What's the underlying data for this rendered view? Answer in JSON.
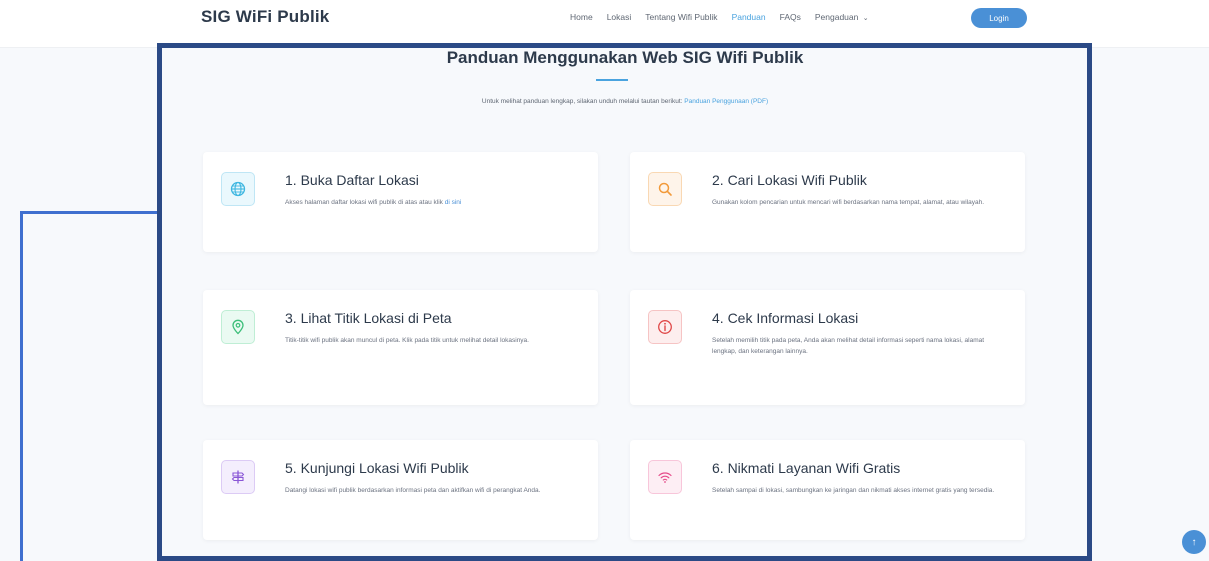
{
  "header": {
    "brand": "SIG WiFi Publik",
    "nav": [
      {
        "label": "Home"
      },
      {
        "label": "Lokasi"
      },
      {
        "label": "Tentang Wifi Publik"
      },
      {
        "label": "Panduan"
      },
      {
        "label": "FAQs"
      },
      {
        "label": "Pengaduan"
      }
    ],
    "nav_dropdown_caret": "⌄",
    "login_label": "Login"
  },
  "section": {
    "title": "Panduan Menggunakan Web SIG Wifi Publik",
    "intro_text": "Untuk melihat panduan lengkap, silakan unduh melalui tautan berikut:",
    "intro_link": "Panduan Penggunaan (PDF)"
  },
  "cards": [
    {
      "title": "1. Buka Daftar Lokasi",
      "desc": "Akses halaman daftar lokasi wifi publik di atas atau klik",
      "desc_link": "di sini",
      "icon": "globe-icon",
      "color": "#3db6e0"
    },
    {
      "title": "2. Cari Lokasi Wifi Publik",
      "desc": "Gunakan kolom pencarian untuk mencari wifi berdasarkan nama tempat, alamat, atau wilayah.",
      "icon": "search-icon",
      "color": "#f29a3a"
    },
    {
      "title": "3. Lihat Titik Lokasi di Peta",
      "desc": "Titik-titik wifi publik akan muncul di peta. Klik pada titik untuk melihat detail lokasinya.",
      "icon": "map-pin-icon",
      "color": "#3dbf7a"
    },
    {
      "title": "4. Cek Informasi Lokasi",
      "desc": "Setelah memilih titik pada peta, Anda akan melihat detail informasi seperti nama lokasi, alamat lengkap, dan keterangan lainnya.",
      "icon": "info-icon",
      "color": "#e04848"
    },
    {
      "title": "5. Kunjungi Lokasi Wifi Publik",
      "desc": "Datangi lokasi wifi publik berdasarkan informasi peta dan aktifkan wifi di perangkat Anda.",
      "icon": "signpost-icon",
      "color": "#8a56d6"
    },
    {
      "title": "6. Nikmati Layanan Wifi Gratis",
      "desc": "Setelah sampai di lokasi, sambungkan ke jaringan dan nikmati akses internet gratis yang tersedia.",
      "icon": "wifi-icon",
      "color": "#e64c8a"
    }
  ],
  "scroll_top_icon": "arrow-up-icon",
  "scroll_top_glyph": "↑"
}
